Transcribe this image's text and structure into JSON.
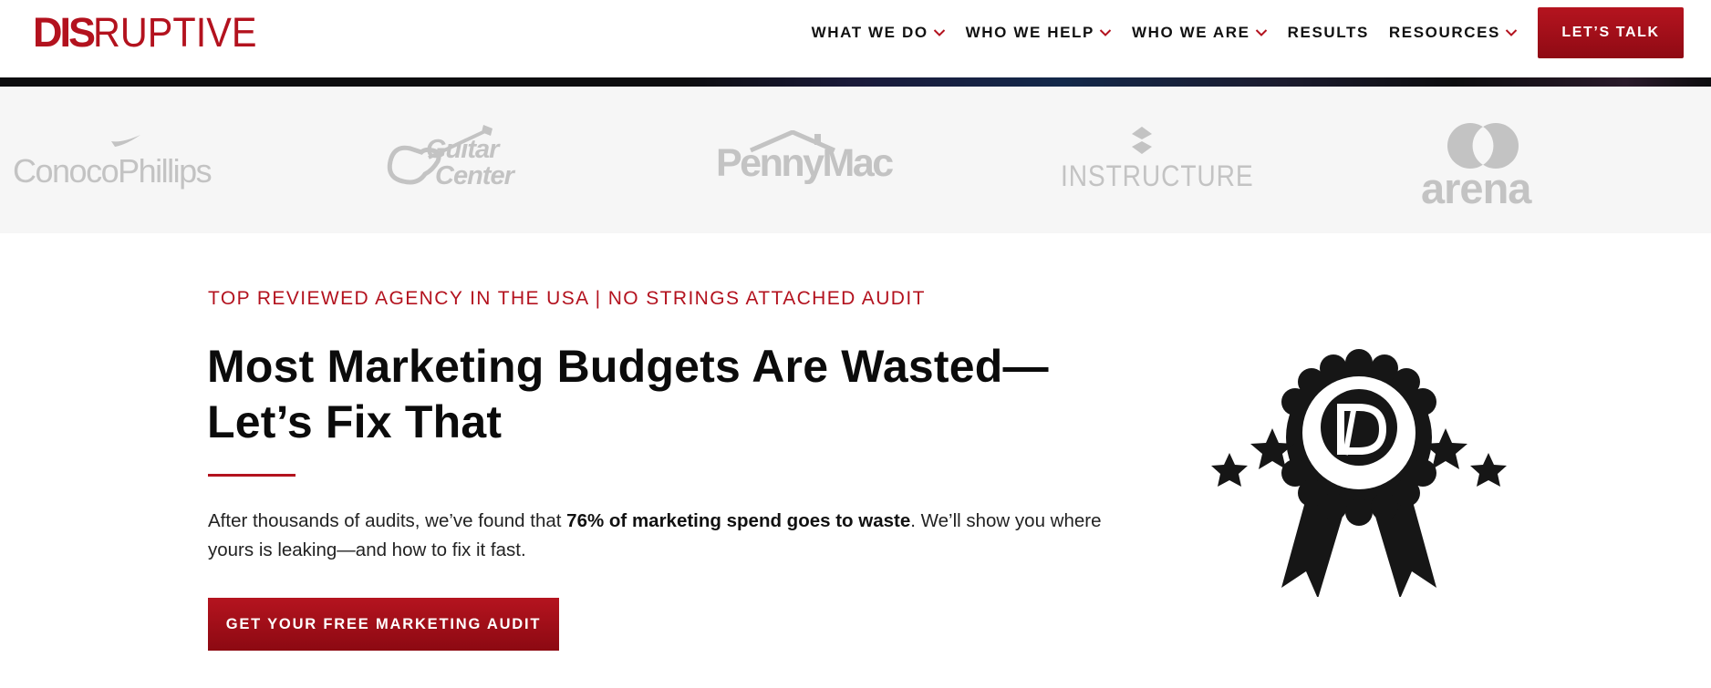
{
  "header": {
    "logo": {
      "bold": "DIS",
      "thin": "RUPTIVE"
    },
    "nav": [
      {
        "label": "WHAT WE DO",
        "has_dropdown": true
      },
      {
        "label": "WHO WE HELP",
        "has_dropdown": true
      },
      {
        "label": "WHO WE ARE",
        "has_dropdown": true
      },
      {
        "label": "RESULTS",
        "has_dropdown": false
      },
      {
        "label": "RESOURCES",
        "has_dropdown": true
      }
    ],
    "cta_label": "LET’S TALK"
  },
  "client_logos": [
    {
      "name": "ConocoPhillips",
      "icon": "conocophillips-logo"
    },
    {
      "name": "Guitar",
      "name2": "Center",
      "icon": "guitar-center-logo"
    },
    {
      "name": "PennyMac",
      "icon": "pennymac-logo"
    },
    {
      "name": "INSTRUCTURE",
      "icon": "instructure-logo"
    },
    {
      "name": "arena",
      "icon": "arena-logo"
    }
  ],
  "hero": {
    "eyebrow": "TOP REVIEWED AGENCY IN THE USA | NO STRINGS ATTACHED AUDIT",
    "headline_line1": "Most Marketing Budgets Are Wasted—",
    "headline_line2": "Let’s Fix That",
    "body_prefix": "After thousands of audits, we’ve found that ",
    "body_bold": "76% of marketing spend goes to waste",
    "body_suffix": ". We’ll show you where yours is leaking—and how to fix it fast.",
    "cta_label": "GET YOUR FREE MARKETING AUDIT",
    "award_icon": "award-ribbon-icon"
  },
  "colors": {
    "brand_red": "#b3121e",
    "logo_grey": "#c3c3c3",
    "band_bg": "#f6f6f6"
  }
}
